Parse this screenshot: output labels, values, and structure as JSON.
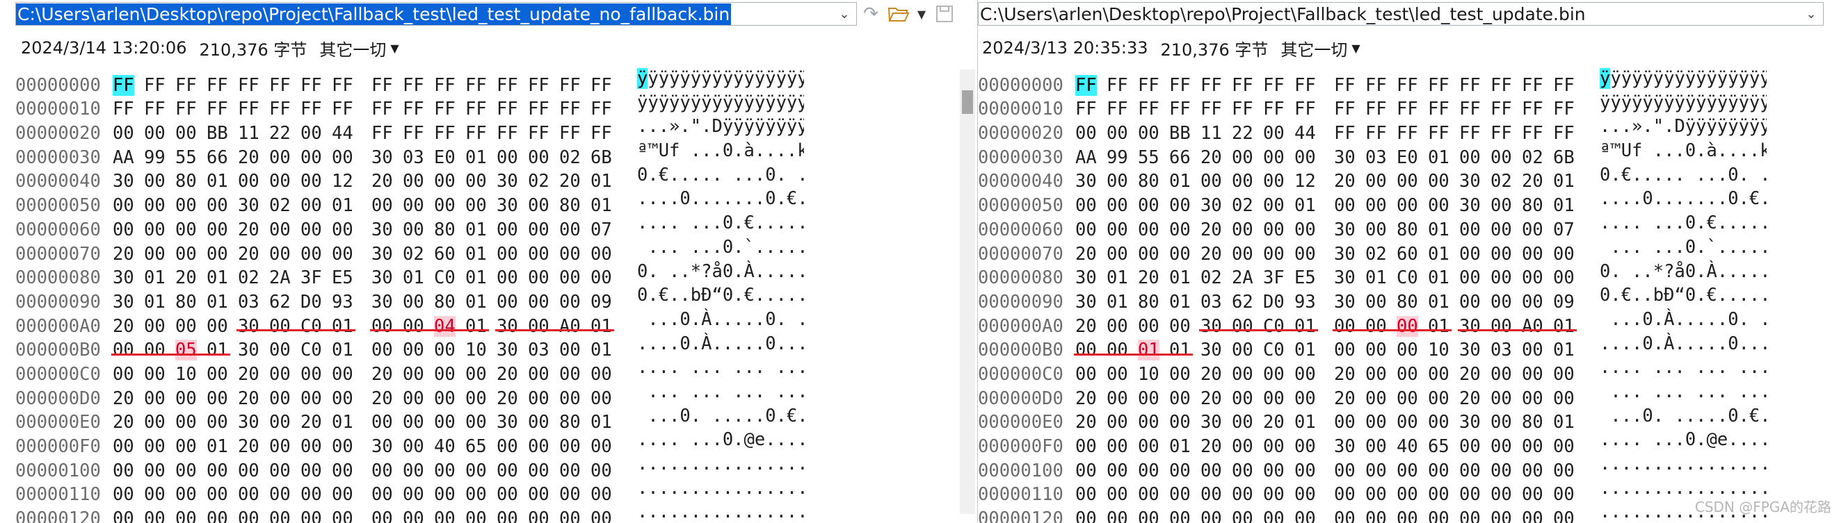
{
  "left": {
    "path": "C:\\Users\\arlen\\Desktop\\repo\\Project\\Fallback_test\\led_test_update_no_fallback.bin",
    "date": "2024/3/14 13:20:06",
    "size": "210,376 字节",
    "encoding": "其它一切",
    "rows": [
      {
        "addr": "00000000",
        "bytes": [
          "FF",
          "FF",
          "FF",
          "FF",
          "FF",
          "FF",
          "FF",
          "FF",
          "FF",
          "FF",
          "FF",
          "FF",
          "FF",
          "FF",
          "FF",
          "FF"
        ],
        "ascii": "ÿÿÿÿÿÿÿÿÿÿÿÿÿÿÿÿ"
      },
      {
        "addr": "00000010",
        "bytes": [
          "FF",
          "FF",
          "FF",
          "FF",
          "FF",
          "FF",
          "FF",
          "FF",
          "FF",
          "FF",
          "FF",
          "FF",
          "FF",
          "FF",
          "FF",
          "FF"
        ],
        "ascii": "ÿÿÿÿÿÿÿÿÿÿÿÿÿÿÿÿ"
      },
      {
        "addr": "00000020",
        "bytes": [
          "00",
          "00",
          "00",
          "BB",
          "11",
          "22",
          "00",
          "44",
          "FF",
          "FF",
          "FF",
          "FF",
          "FF",
          "FF",
          "FF",
          "FF"
        ],
        "ascii": "...».\".Dÿÿÿÿÿÿÿÿ"
      },
      {
        "addr": "00000030",
        "bytes": [
          "AA",
          "99",
          "55",
          "66",
          "20",
          "00",
          "00",
          "00",
          "30",
          "03",
          "E0",
          "01",
          "00",
          "00",
          "02",
          "6B"
        ],
        "ascii": "ª™Uf ...0.à....k"
      },
      {
        "addr": "00000040",
        "bytes": [
          "30",
          "00",
          "80",
          "01",
          "00",
          "00",
          "00",
          "12",
          "20",
          "00",
          "00",
          "00",
          "30",
          "02",
          "20",
          "01"
        ],
        "ascii": "0.€..... ...0. ."
      },
      {
        "addr": "00000050",
        "bytes": [
          "00",
          "00",
          "00",
          "00",
          "30",
          "02",
          "00",
          "01",
          "00",
          "00",
          "00",
          "00",
          "30",
          "00",
          "80",
          "01"
        ],
        "ascii": "....0.......0.€."
      },
      {
        "addr": "00000060",
        "bytes": [
          "00",
          "00",
          "00",
          "00",
          "20",
          "00",
          "00",
          "00",
          "30",
          "00",
          "80",
          "01",
          "00",
          "00",
          "00",
          "07"
        ],
        "ascii": ".... ...0.€....."
      },
      {
        "addr": "00000070",
        "bytes": [
          "20",
          "00",
          "00",
          "00",
          "20",
          "00",
          "00",
          "00",
          "30",
          "02",
          "60",
          "01",
          "00",
          "00",
          "00",
          "00"
        ],
        "ascii": " ... ...0.`....."
      },
      {
        "addr": "00000080",
        "bytes": [
          "30",
          "01",
          "20",
          "01",
          "02",
          "2A",
          "3F",
          "E5",
          "30",
          "01",
          "C0",
          "01",
          "00",
          "00",
          "00",
          "00"
        ],
        "ascii": "0. ..*?å0.À....."
      },
      {
        "addr": "00000090",
        "bytes": [
          "30",
          "01",
          "80",
          "01",
          "03",
          "62",
          "D0",
          "93",
          "30",
          "00",
          "80",
          "01",
          "00",
          "00",
          "00",
          "09"
        ],
        "ascii": "0.€..bÐ“0.€....."
      },
      {
        "addr": "000000A0",
        "bytes": [
          "20",
          "00",
          "00",
          "00",
          "30",
          "00",
          "C0",
          "01",
          "00",
          "00",
          "04",
          "01",
          "30",
          "00",
          "A0",
          "01"
        ],
        "ascii": " ...0.À.....0. ."
      },
      {
        "addr": "000000B0",
        "bytes": [
          "00",
          "00",
          "05",
          "01",
          "30",
          "00",
          "C0",
          "01",
          "00",
          "00",
          "00",
          "10",
          "30",
          "03",
          "00",
          "01"
        ],
        "ascii": "....0.À.....0..."
      },
      {
        "addr": "000000C0",
        "bytes": [
          "00",
          "00",
          "10",
          "00",
          "20",
          "00",
          "00",
          "00",
          "20",
          "00",
          "00",
          "00",
          "20",
          "00",
          "00",
          "00"
        ],
        "ascii": ".... ... ... ..."
      },
      {
        "addr": "000000D0",
        "bytes": [
          "20",
          "00",
          "00",
          "00",
          "20",
          "00",
          "00",
          "00",
          "20",
          "00",
          "00",
          "00",
          "20",
          "00",
          "00",
          "00"
        ],
        "ascii": " ... ... ... ..."
      },
      {
        "addr": "000000E0",
        "bytes": [
          "20",
          "00",
          "00",
          "00",
          "30",
          "00",
          "20",
          "01",
          "00",
          "00",
          "00",
          "00",
          "30",
          "00",
          "80",
          "01"
        ],
        "ascii": " ...0. .....0.€."
      },
      {
        "addr": "000000F0",
        "bytes": [
          "00",
          "00",
          "00",
          "01",
          "20",
          "00",
          "00",
          "00",
          "30",
          "00",
          "40",
          "65",
          "00",
          "00",
          "00",
          "00"
        ],
        "ascii": ".... ...0.@e...."
      },
      {
        "addr": "00000100",
        "bytes": [
          "00",
          "00",
          "00",
          "00",
          "00",
          "00",
          "00",
          "00",
          "00",
          "00",
          "00",
          "00",
          "00",
          "00",
          "00",
          "00"
        ],
        "ascii": "................"
      },
      {
        "addr": "00000110",
        "bytes": [
          "00",
          "00",
          "00",
          "00",
          "00",
          "00",
          "00",
          "00",
          "00",
          "00",
          "00",
          "00",
          "00",
          "00",
          "00",
          "00"
        ],
        "ascii": "................"
      },
      {
        "addr": "00000120",
        "bytes": [
          "00",
          "00",
          "00",
          "00",
          "00",
          "00",
          "00",
          "00",
          "00",
          "00",
          "00",
          "00",
          "00",
          "00",
          "00",
          "00"
        ],
        "ascii": "................"
      }
    ],
    "highlight_bytes": [
      [
        10,
        10
      ],
      [
        11,
        2
      ]
    ]
  },
  "right": {
    "path": "C:\\Users\\arlen\\Desktop\\repo\\Project\\Fallback_test\\led_test_update.bin",
    "date": "2024/3/13 20:35:33",
    "size": "210,376 字节",
    "encoding": "其它一切",
    "rows": [
      {
        "addr": "00000000",
        "bytes": [
          "FF",
          "FF",
          "FF",
          "FF",
          "FF",
          "FF",
          "FF",
          "FF",
          "FF",
          "FF",
          "FF",
          "FF",
          "FF",
          "FF",
          "FF",
          "FF"
        ],
        "ascii": "ÿÿÿÿÿÿÿÿÿÿÿÿÿÿÿÿ"
      },
      {
        "addr": "00000010",
        "bytes": [
          "FF",
          "FF",
          "FF",
          "FF",
          "FF",
          "FF",
          "FF",
          "FF",
          "FF",
          "FF",
          "FF",
          "FF",
          "FF",
          "FF",
          "FF",
          "FF"
        ],
        "ascii": "ÿÿÿÿÿÿÿÿÿÿÿÿÿÿÿÿ"
      },
      {
        "addr": "00000020",
        "bytes": [
          "00",
          "00",
          "00",
          "BB",
          "11",
          "22",
          "00",
          "44",
          "FF",
          "FF",
          "FF",
          "FF",
          "FF",
          "FF",
          "FF",
          "FF"
        ],
        "ascii": "...».\".Dÿÿÿÿÿÿÿÿ"
      },
      {
        "addr": "00000030",
        "bytes": [
          "AA",
          "99",
          "55",
          "66",
          "20",
          "00",
          "00",
          "00",
          "30",
          "03",
          "E0",
          "01",
          "00",
          "00",
          "02",
          "6B"
        ],
        "ascii": "ª™Uf ...0.à....k"
      },
      {
        "addr": "00000040",
        "bytes": [
          "30",
          "00",
          "80",
          "01",
          "00",
          "00",
          "00",
          "12",
          "20",
          "00",
          "00",
          "00",
          "30",
          "02",
          "20",
          "01"
        ],
        "ascii": "0.€..... ...0. ."
      },
      {
        "addr": "00000050",
        "bytes": [
          "00",
          "00",
          "00",
          "00",
          "30",
          "02",
          "00",
          "01",
          "00",
          "00",
          "00",
          "00",
          "30",
          "00",
          "80",
          "01"
        ],
        "ascii": "....0.......0.€."
      },
      {
        "addr": "00000060",
        "bytes": [
          "00",
          "00",
          "00",
          "00",
          "20",
          "00",
          "00",
          "00",
          "30",
          "00",
          "80",
          "01",
          "00",
          "00",
          "00",
          "07"
        ],
        "ascii": ".... ...0.€....."
      },
      {
        "addr": "00000070",
        "bytes": [
          "20",
          "00",
          "00",
          "00",
          "20",
          "00",
          "00",
          "00",
          "30",
          "02",
          "60",
          "01",
          "00",
          "00",
          "00",
          "00"
        ],
        "ascii": " ... ...0.`....."
      },
      {
        "addr": "00000080",
        "bytes": [
          "30",
          "01",
          "20",
          "01",
          "02",
          "2A",
          "3F",
          "E5",
          "30",
          "01",
          "C0",
          "01",
          "00",
          "00",
          "00",
          "00"
        ],
        "ascii": "0. ..*?å0.À....."
      },
      {
        "addr": "00000090",
        "bytes": [
          "30",
          "01",
          "80",
          "01",
          "03",
          "62",
          "D0",
          "93",
          "30",
          "00",
          "80",
          "01",
          "00",
          "00",
          "00",
          "09"
        ],
        "ascii": "0.€..bÐ“0.€....."
      },
      {
        "addr": "000000A0",
        "bytes": [
          "20",
          "00",
          "00",
          "00",
          "30",
          "00",
          "C0",
          "01",
          "00",
          "00",
          "00",
          "01",
          "30",
          "00",
          "A0",
          "01"
        ],
        "ascii": " ...0.À.....0. ."
      },
      {
        "addr": "000000B0",
        "bytes": [
          "00",
          "00",
          "01",
          "01",
          "30",
          "00",
          "C0",
          "01",
          "00",
          "00",
          "00",
          "10",
          "30",
          "03",
          "00",
          "01"
        ],
        "ascii": "....0.À.....0..."
      },
      {
        "addr": "000000C0",
        "bytes": [
          "00",
          "00",
          "10",
          "00",
          "20",
          "00",
          "00",
          "00",
          "20",
          "00",
          "00",
          "00",
          "20",
          "00",
          "00",
          "00"
        ],
        "ascii": ".... ... ... ..."
      },
      {
        "addr": "000000D0",
        "bytes": [
          "20",
          "00",
          "00",
          "00",
          "20",
          "00",
          "00",
          "00",
          "20",
          "00",
          "00",
          "00",
          "20",
          "00",
          "00",
          "00"
        ],
        "ascii": " ... ... ... ..."
      },
      {
        "addr": "000000E0",
        "bytes": [
          "20",
          "00",
          "00",
          "00",
          "30",
          "00",
          "20",
          "01",
          "00",
          "00",
          "00",
          "00",
          "30",
          "00",
          "80",
          "01"
        ],
        "ascii": " ...0. .....0.€."
      },
      {
        "addr": "000000F0",
        "bytes": [
          "00",
          "00",
          "00",
          "01",
          "20",
          "00",
          "00",
          "00",
          "30",
          "00",
          "40",
          "65",
          "00",
          "00",
          "00",
          "00"
        ],
        "ascii": ".... ...0.@e...."
      },
      {
        "addr": "00000100",
        "bytes": [
          "00",
          "00",
          "00",
          "00",
          "00",
          "00",
          "00",
          "00",
          "00",
          "00",
          "00",
          "00",
          "00",
          "00",
          "00",
          "00"
        ],
        "ascii": "................"
      },
      {
        "addr": "00000110",
        "bytes": [
          "00",
          "00",
          "00",
          "00",
          "00",
          "00",
          "00",
          "00",
          "00",
          "00",
          "00",
          "00",
          "00",
          "00",
          "00",
          "00"
        ],
        "ascii": "................"
      },
      {
        "addr": "00000120",
        "bytes": [
          "00",
          "00",
          "00",
          "00",
          "00",
          "00",
          "00",
          "00",
          "00",
          "00",
          "00",
          "00",
          "00",
          "00",
          "00",
          "00"
        ],
        "ascii": "................"
      }
    ],
    "highlight_bytes": [
      [
        10,
        10
      ],
      [
        11,
        2
      ]
    ]
  },
  "underlines": [
    [
      10,
      4,
      7
    ],
    [
      10,
      8,
      11
    ],
    [
      10,
      12,
      15
    ],
    [
      11,
      0,
      3
    ]
  ],
  "watermark": "CSDN @FPGA的花路",
  "colors": {
    "cursor": "#3df0ff",
    "diff_bg": "#ffd0d8",
    "diff_fg": "#d0002a",
    "underline": "#e0202a",
    "selection": "#0a64d8"
  },
  "icons": {
    "undo": "undo-icon",
    "folder": "folder-open-icon",
    "save": "save-icon",
    "dropdown": "chevron-down-icon"
  }
}
